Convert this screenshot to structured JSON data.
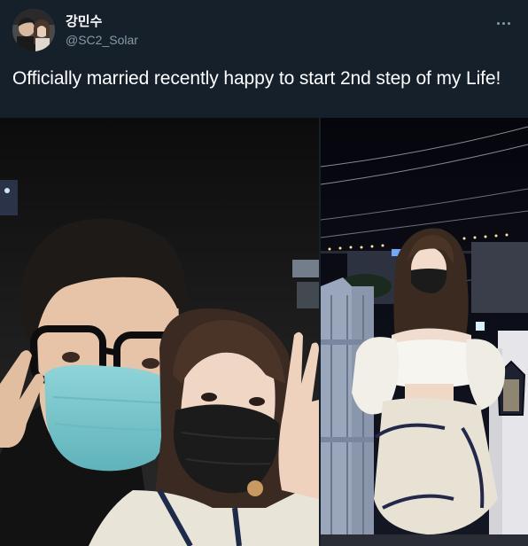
{
  "tweet": {
    "display_name": "강민수",
    "handle": "@SC2_Solar",
    "text": "Officially married recently happy to start 2nd step of my Life!",
    "avatar_icon": "avatar-photo",
    "more_icon": "more-options-icon",
    "media": [
      {
        "name": "selfie-photo"
      },
      {
        "name": "night-outdoor-photo"
      }
    ]
  },
  "colors": {
    "background": "#15202b",
    "text": "#ffffff",
    "muted": "#8899a6"
  }
}
